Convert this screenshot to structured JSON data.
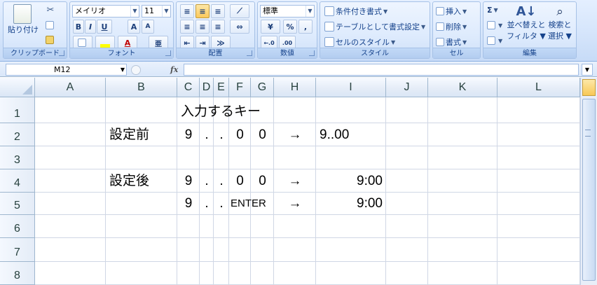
{
  "ribbon": {
    "clipboard": {
      "paste_label": "貼り付け",
      "group_label": "クリップボード"
    },
    "font": {
      "font_name": "メイリオ",
      "font_size": "11",
      "group_label": "フォント",
      "bold": "B",
      "italic": "I",
      "underline": "U",
      "grow": "A",
      "shrink": "A",
      "font_color": "A"
    },
    "alignment": {
      "group_label": "配置"
    },
    "number": {
      "format": "標準",
      "percent": "%",
      "comma": ",",
      "group_label": "数値",
      "inc_decimal": "←.0",
      "dec_decimal": ".00"
    },
    "styles": {
      "conditional": "条件付き書式",
      "table": "テーブルとして書式設定",
      "cell_styles": "セルのスタイル",
      "group_label": "スタイル"
    },
    "cells": {
      "insert": "挿入",
      "delete": "削除",
      "format": "書式",
      "group_label": "セル"
    },
    "editing": {
      "sigma": "Σ",
      "sort_filter_line1": "並べ替えと",
      "sort_filter_line2": "フィルタ",
      "find_line1": "検索と",
      "find_line2": "選択",
      "group_label": "編集"
    }
  },
  "formula_bar": {
    "name_box": "M12",
    "fx": "fx",
    "formula": ""
  },
  "columns": [
    "A",
    "B",
    "C",
    "D",
    "E",
    "F",
    "G",
    "H",
    "I",
    "J",
    "K",
    "L"
  ],
  "rows": [
    "1",
    "2",
    "3",
    "4",
    "5",
    "6",
    "7",
    "8"
  ],
  "cells": {
    "C1": "入力するキー",
    "B2": "設定前",
    "C2": "9",
    "D2": ".",
    "E2": ".",
    "F2": "0",
    "G2": "0",
    "H2": "→",
    "I2": "9..00",
    "B4": "設定後",
    "C4": "9",
    "D4": ".",
    "E4": ".",
    "F4": "0",
    "G4": "0",
    "H4": "→",
    "I4": "9:00",
    "C5": "9",
    "D5": ".",
    "E5": ".",
    "F5": "ENTER",
    "H5": "→",
    "I5": "9:00"
  },
  "colors": {
    "grid": "#d0d7e5",
    "header_text": "#27413e",
    "ribbon_text": "#15428b"
  }
}
